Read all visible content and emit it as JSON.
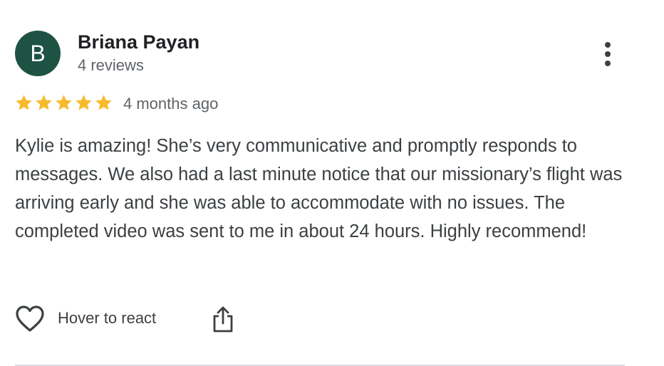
{
  "reviewer": {
    "avatar_initial": "B",
    "name": "Briana Payan",
    "review_count": "4 reviews"
  },
  "rating": {
    "stars": 5,
    "max_stars": 5,
    "time_ago": "4 months ago"
  },
  "review_text": "Kylie is amazing! She’s very communicative and promptly responds to messages. We also had a last minute notice that our missionary’s flight was arriving early and she was able to accommodate with no issues. The completed video was sent to me in about 24 hours. Highly recommend!",
  "actions": {
    "react_label": "Hover to react",
    "icons": [
      "heart-icon",
      "share-icon",
      "more-options-icon"
    ]
  },
  "colors": {
    "avatar_bg": "#1e5344",
    "star": "#f6bb2d",
    "secondary_text": "#5f6368",
    "body_text": "#3c4043"
  }
}
